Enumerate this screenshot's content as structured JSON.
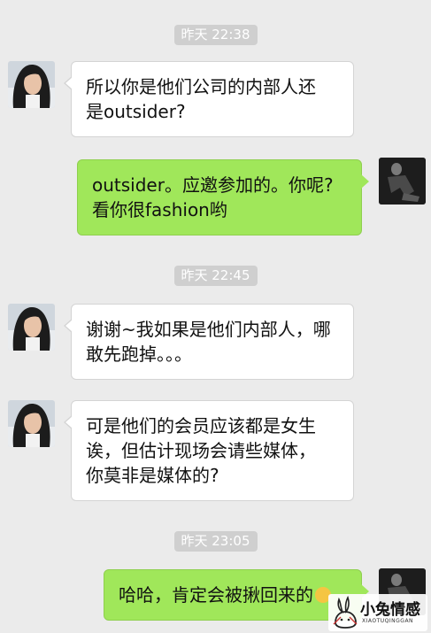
{
  "messages": [
    {
      "kind": "timestamp",
      "text": "昨天 22:38"
    },
    {
      "kind": "incoming",
      "lines": [
        "所以你是他们公司的内部人还",
        "是outsider?"
      ]
    },
    {
      "kind": "outgoing",
      "lines": [
        "outsider。应邀参加的。你呢?",
        "看你很fashion哟"
      ]
    },
    {
      "kind": "timestamp",
      "text": "昨天 22:45"
    },
    {
      "kind": "incoming",
      "lines": [
        "谢谢~我如果是他们内部人，哪",
        "敢先跑掉。。。"
      ]
    },
    {
      "kind": "incoming",
      "lines": [
        "可是他们的会员应该都是女生",
        "诶，但估计现场会请些媒体，",
        "你莫非是媒体的?"
      ]
    },
    {
      "kind": "timestamp",
      "text": "昨天 23:05"
    },
    {
      "kind": "outgoing",
      "lines": [
        "哈哈，肯定会被揪回来的"
      ],
      "emoji": "smile-emoji"
    }
  ],
  "watermark": {
    "name": "小兔情感",
    "sub": "XIAOTUQINGGAN",
    "icon": "rabbit-logo-icon"
  },
  "colors": {
    "background": "#ebebeb",
    "incoming_bubble": "#ffffff",
    "outgoing_bubble": "#a0e75a",
    "timestamp_bg": "#cfcfcf"
  }
}
